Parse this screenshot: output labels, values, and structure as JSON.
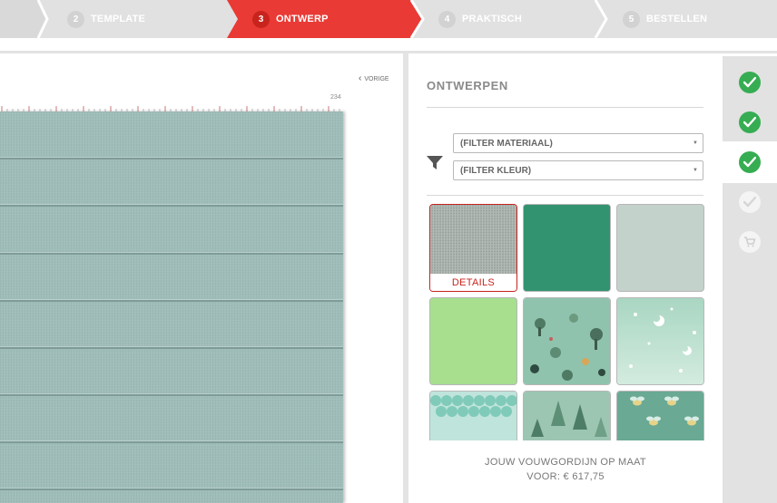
{
  "steps": [
    {
      "number": "2",
      "label": "TEMPLATE"
    },
    {
      "number": "3",
      "label": "ONTWERP"
    },
    {
      "number": "4",
      "label": "PRAKTISCH"
    },
    {
      "number": "5",
      "label": "BESTELLEN"
    }
  ],
  "active_step": "3",
  "colors": {
    "accent": "#e93a35",
    "success": "#36ad52",
    "fabric": "#9fbdb9"
  },
  "canvas": {
    "back_label": "VORIGE",
    "width_label": "234"
  },
  "panel": {
    "title": "ONTWERPEN",
    "filters": [
      {
        "name": "material",
        "selected": "(FILTER MATERIAAL)"
      },
      {
        "name": "color",
        "selected": "(FILTER KLEUR)"
      }
    ],
    "swatches": [
      {
        "name": "grey-green-linen",
        "selected": true,
        "details_label": "DETAILS"
      },
      {
        "name": "emerald-green"
      },
      {
        "name": "pale-sage"
      },
      {
        "name": "light-green"
      },
      {
        "name": "forest-animals-print"
      },
      {
        "name": "moon-stars-print"
      },
      {
        "name": "scallop-wave-print"
      },
      {
        "name": "pine-forest-print"
      },
      {
        "name": "bee-print"
      }
    ],
    "price_label": "JOUW VOUWGORDIJN OP MAAT",
    "price_value": "VOOR: € 617,75"
  },
  "sidebar": [
    {
      "name": "step-check-1",
      "state": "done"
    },
    {
      "name": "step-check-2",
      "state": "done"
    },
    {
      "name": "step-check-3",
      "state": "done",
      "active": true
    },
    {
      "name": "step-check-4",
      "state": "todo"
    },
    {
      "name": "cart",
      "state": "todo",
      "icon": "cart-icon"
    }
  ]
}
